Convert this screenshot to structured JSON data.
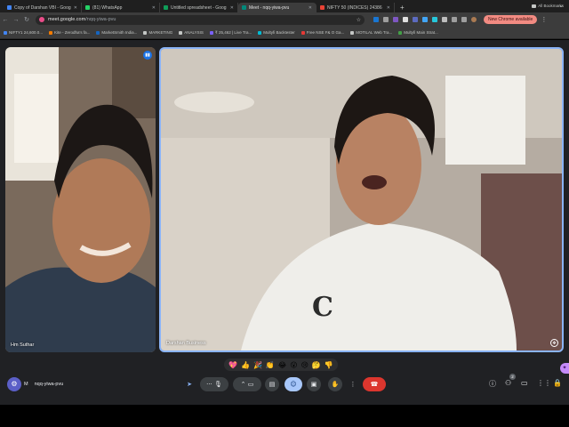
{
  "browser": {
    "tabs": [
      {
        "title": "Copy of Darshan VBI - Goog",
        "color": "#4285f4",
        "active": false
      },
      {
        "title": "(81) WhatsApp",
        "color": "#25d366",
        "active": false
      },
      {
        "title": "Untitled spreadsheet - Goog",
        "color": "#0f9d58",
        "active": false
      },
      {
        "title": "Meet - nqq-yiwa-pvu",
        "color": "#00897b",
        "active": true
      },
      {
        "title": "NIFTY 50 (INDICES) 24386",
        "color": "#ea4335",
        "active": false
      }
    ],
    "new_tab": "+",
    "url_host": "meet.google.com",
    "url_path": "/nqq-yiwa-pvu",
    "new_chrome_label": "New Chrome available",
    "bookmarks": [
      {
        "label": "NIFTY1 24,600.0...",
        "color": "#4285f4"
      },
      {
        "label": "Kite - Zerodha's fa...",
        "color": "#f57c00"
      },
      {
        "label": "MarketSmith India...",
        "color": "#1565c0"
      },
      {
        "label": "MARKETING",
        "color": "#c4c7c5"
      },
      {
        "label": "ANALYSIS",
        "color": "#c4c7c5"
      },
      {
        "label": "₹ 25,462 | Live Tra...",
        "color": "#7b61ff"
      },
      {
        "label": "Multyfi Backtester",
        "color": "#00bcd4"
      },
      {
        "label": "Free NSE F& O Ga...",
        "color": "#e53935"
      },
      {
        "label": "MOTILAL Web Tra...",
        "color": "#c4c7c5"
      },
      {
        "label": "Multyfi Main Strat...",
        "color": "#43a047"
      }
    ],
    "all_bookmarks": "All Bookmarks"
  },
  "meet": {
    "participants": [
      {
        "name": "Hm Suthar"
      },
      {
        "name": "Darshan Business"
      }
    ],
    "reactions": [
      "💖",
      "👍",
      "🎉",
      "👏",
      "😂",
      "😮",
      "😢",
      "🤔",
      "👎"
    ],
    "clock_suffix": "M",
    "meeting_code": "nqq-yiwa-pvu",
    "people_count": "2",
    "colors": {
      "end_call": "#dc362e",
      "accent": "#8ab4f8",
      "active_control": "#a8c7fa"
    }
  }
}
